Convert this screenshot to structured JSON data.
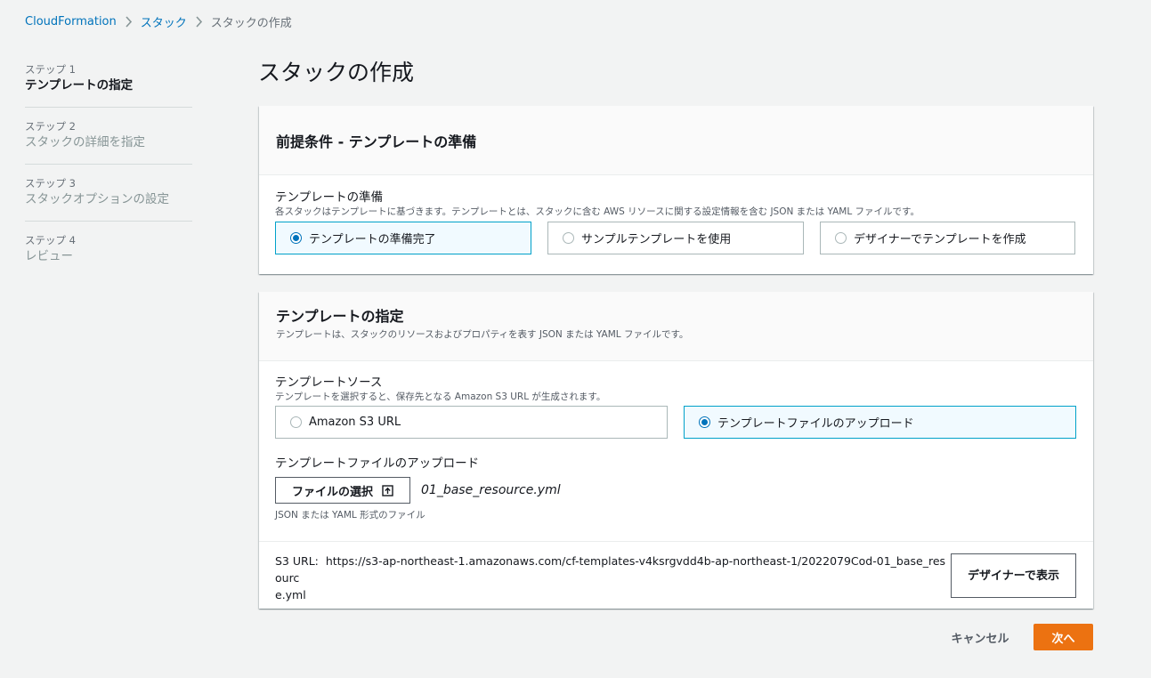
{
  "breadcrumb": {
    "items": [
      "CloudFormation",
      "スタック",
      "スタックの作成"
    ]
  },
  "steps": [
    {
      "num": "ステップ 1",
      "label": "テンプレートの指定"
    },
    {
      "num": "ステップ 2",
      "label": "スタックの詳細を指定"
    },
    {
      "num": "ステップ 3",
      "label": "スタックオプションの設定"
    },
    {
      "num": "ステップ 4",
      "label": "レビュー"
    }
  ],
  "page_title": "スタックの作成",
  "prereq": {
    "title": "前提条件 - テンプレートの準備",
    "field_label": "テンプレートの準備",
    "field_desc": "各スタックはテンプレートに基づきます。テンプレートとは、スタックに含む AWS リソースに関する設定情報を含む JSON または YAML ファイルです。",
    "options": [
      "テンプレートの準備完了",
      "サンプルテンプレートを使用",
      "デザイナーでテンプレートを作成"
    ],
    "selected": "テンプレートの準備完了"
  },
  "specify": {
    "title": "テンプレートの指定",
    "desc": "テンプレートは、スタックのリソースおよびプロパティを表す JSON または YAML ファイルです。",
    "source_label": "テンプレートソース",
    "source_desc": "テンプレートを選択すると、保存先となる Amazon S3 URL が生成されます。",
    "source_options": [
      "Amazon S3 URL",
      "テンプレートファイルのアップロード"
    ],
    "source_selected": "テンプレートファイルのアップロード",
    "upload_label": "テンプレートファイルのアップロード",
    "choose_file_label": "ファイルの選択",
    "file_name": "01_base_resource.yml",
    "file_hint": "JSON または YAML 形式のファイル",
    "s3_url_label": "S3 URL:",
    "s3_url_line1": "https://s3-ap-northeast-1.amazonaws.com/cf-templates-v4ksrgvdd4b-ap-northeast-1/2022079Cod-01_base_resourc",
    "s3_url_line2": "e.yml",
    "designer_button": "デザイナーで表示"
  },
  "footer": {
    "cancel": "キャンセル",
    "next": "次へ"
  },
  "colors": {
    "link": "#0073bb",
    "primary": "#ec7211",
    "selected_border": "#00a1c9",
    "selected_bg": "#f1faff"
  }
}
